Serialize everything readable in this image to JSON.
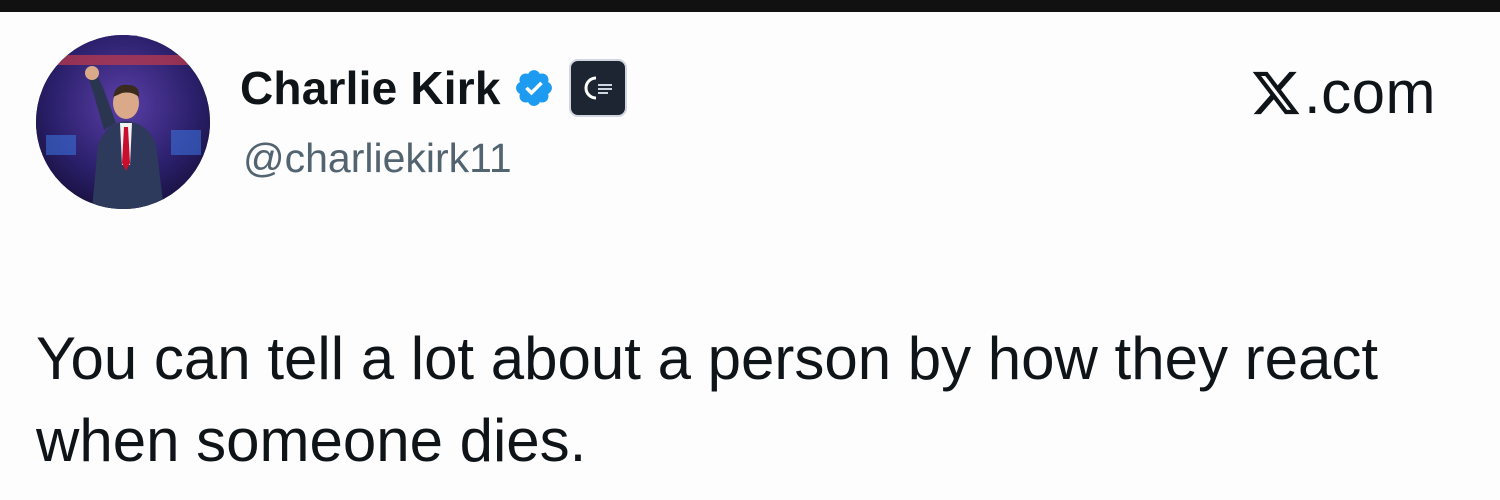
{
  "tweet": {
    "display_name": "Charlie Kirk",
    "handle": "@charliekirk11",
    "site": ".com",
    "text": "You can tell a lot about a person by how they react when someone dies.",
    "verified": true
  },
  "icons": {
    "avatar": "profile-photo",
    "verified": "verified-badge-icon",
    "affiliate": "affiliate-logo-icon",
    "site_logo": "x-logo-icon"
  },
  "colors": {
    "verified_blue": "#1d9bf0",
    "text_primary": "#0f1419",
    "text_secondary": "#536471",
    "top_bar": "#111111"
  }
}
